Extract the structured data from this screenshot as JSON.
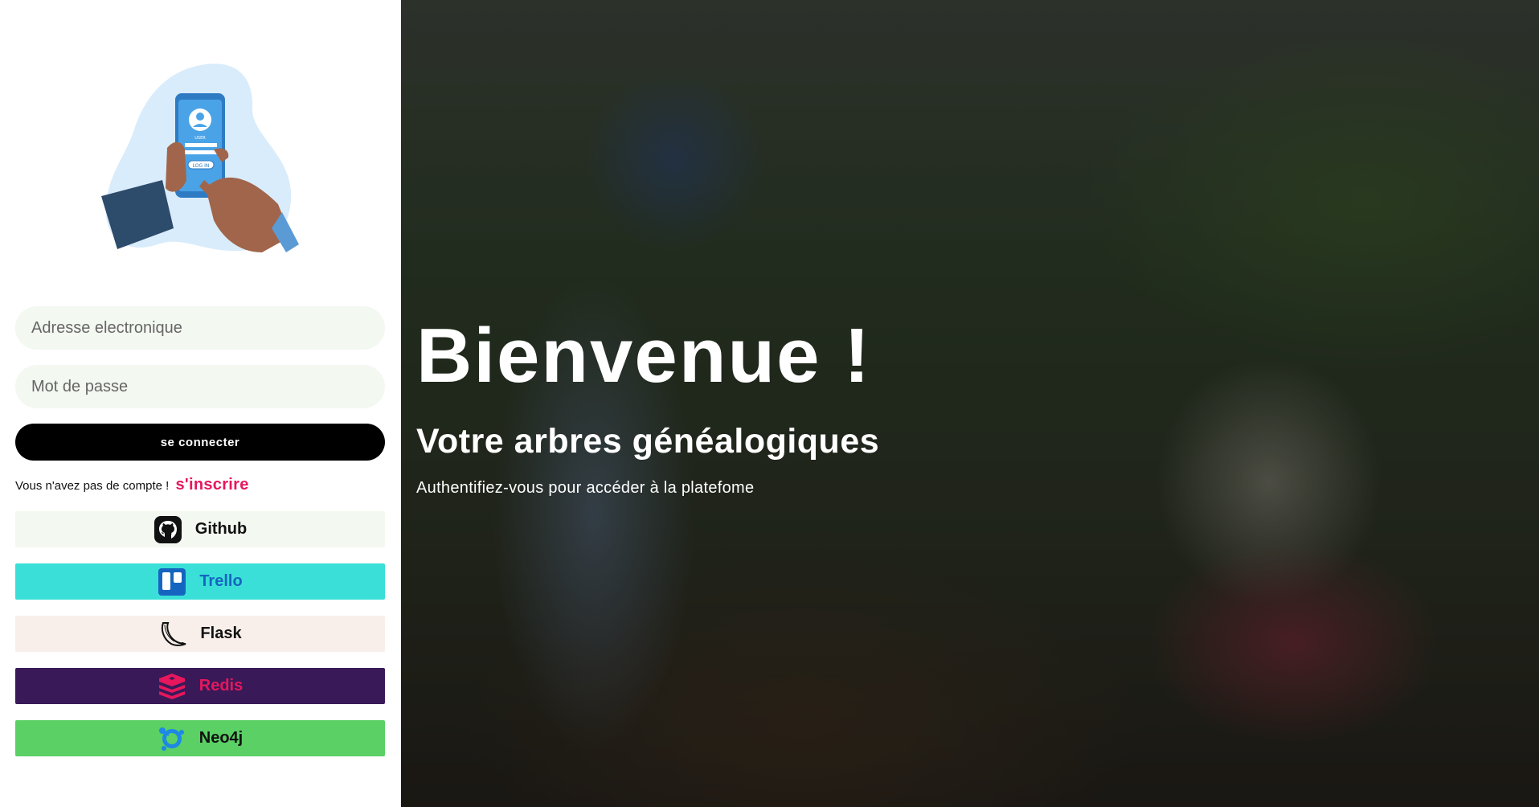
{
  "login": {
    "email_placeholder": "Adresse electronique",
    "password_placeholder": "Mot de passe",
    "submit_label": "se connecter",
    "signup_prompt": "Vous n'avez pas de compte !",
    "signup_link": "s'inscrire"
  },
  "providers": [
    {
      "label": "Github",
      "icon": "github-icon",
      "bg": "#f3f8f1",
      "color": "#111111"
    },
    {
      "label": "Trello",
      "icon": "trello-icon",
      "bg": "#3ae0d8",
      "color": "#1565c0"
    },
    {
      "label": "Flask",
      "icon": "flask-icon",
      "bg": "#f8efea",
      "color": "#111111"
    },
    {
      "label": "Redis",
      "icon": "redis-icon",
      "bg": "#3a1959",
      "color": "#e6175c"
    },
    {
      "label": "Neo4j",
      "icon": "neo4j-icon",
      "bg": "#5ad065",
      "color": "#111111"
    }
  ],
  "hero": {
    "title": "Bienvenue !",
    "subtitle": "Votre arbres généalogiques",
    "tagline": "Authentifiez-vous pour accéder à la platefome"
  },
  "illustration": {
    "screen_user_label": "USER",
    "screen_button_label": "LOG IN"
  },
  "colors": {
    "accent": "#e6175c",
    "button": "#000000",
    "input_bg": "#f3f8f1"
  }
}
